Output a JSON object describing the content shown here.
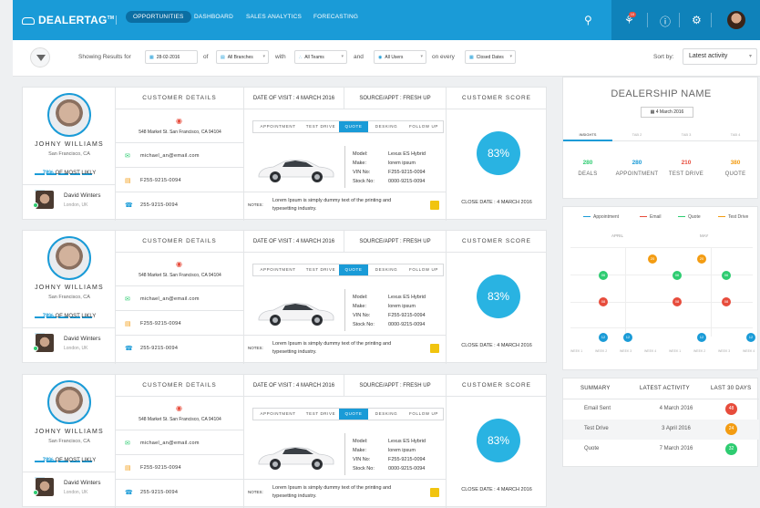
{
  "topbar": {
    "logo": "DEALERTAG",
    "logo_tm": "TM",
    "nav": [
      "OPPORTUNITIES",
      "DASHBOARD",
      "SALES ANALYTICS",
      "FORECASTING"
    ],
    "notification_count": "10",
    "accent": "#1a9bd7"
  },
  "filters": {
    "showing_label": "Showing Results for",
    "date": "28-02-2016",
    "of": "of",
    "branches": "All Branches",
    "with": "with",
    "teams": "All Teams",
    "and": "and",
    "users": "All Users",
    "on_every": "on every",
    "closed_dates": "Closed Dates",
    "sort_label": "Sort by:",
    "sort_value": "Latest activity"
  },
  "card_labels": {
    "customer_details": "CUSTOMER DETAILS",
    "date_of_visit_label": "DATE OF VISIT :",
    "source_label": "SOURCE/APPT :",
    "customer_score": "CUSTOMER SCORE",
    "tabs": [
      "APPOINTMENT",
      "TEST DRIVE",
      "QUOTE",
      "DESKING",
      "FOLLOW UP"
    ],
    "spec_labels": [
      "Model:",
      "Make:",
      "VIN No:",
      "Stock No:"
    ],
    "notes_label": "NOTES:",
    "close_date_label": "CLOSE DATE :",
    "most_likely": "OF MOST LIKLY"
  },
  "cards": [
    {
      "name": "JOHNY WILLIAMS",
      "location": "San Francisco, CA",
      "likely_pct": "78%",
      "agent_name": "David Winters",
      "agent_location": "London, UK",
      "address": "548 Market St. San Francisco, CA 94104",
      "email": "michael_an@email.com",
      "fax": "F255-9215-0094",
      "phone": "255-9215-0094",
      "visit_date": "4 MARCH 2016",
      "source": "FRESH UP",
      "model": "Lexus ES Hybrid",
      "make": "lorem ipsum",
      "vin": "F255-9215-0094",
      "stock": "0000-9215-0094",
      "notes": "Lorem Ipsum is simply dummy text of the printing and typesetting industry.",
      "score": "83%",
      "close_date": "4 MARCH 2016"
    },
    {
      "name": "JOHNY WILLIAMS",
      "location": "San Francisco, CA",
      "likely_pct": "78%",
      "agent_name": "David Winters",
      "agent_location": "London, UK",
      "address": "548 Market St. San Francisco, CA 94104",
      "email": "michael_an@email.com",
      "fax": "F255-9215-0094",
      "phone": "255-9215-0094",
      "visit_date": "4 MARCH 2016",
      "source": "FRESH UP",
      "model": "Lexus ES Hybrid",
      "make": "lorem ipsum",
      "vin": "F255-9215-0094",
      "stock": "0000-9215-0094",
      "notes": "Lorem Ipsum is simply dummy text of the printing and typesetting industry.",
      "score": "83%",
      "close_date": "4 MARCH 2016"
    },
    {
      "name": "JOHNY WILLIAMS",
      "location": "San Francisco, CA",
      "likely_pct": "78%",
      "agent_name": "David Winters",
      "agent_location": "London, UK",
      "address": "548 Market St. San Francisco, CA 94104",
      "email": "michael_an@email.com",
      "fax": "F255-9215-0094",
      "phone": "255-9215-0094",
      "visit_date": "4 MARCH 2016",
      "source": "FRESH UP",
      "model": "Lexus ES Hybrid",
      "make": "lorem ipsum",
      "vin": "F255-9215-0094",
      "stock": "0000-9215-0094",
      "notes": "Lorem Ipsum is simply dummy text of the printing and typesetting industry.",
      "score": "83%",
      "close_date": "4 MARCH 2016"
    }
  ],
  "dealership": {
    "name": "DEALERSHIP NAME",
    "date": "4 March 2016",
    "tabs": [
      "INSIGHTS",
      "TAB 2",
      "TAB 3",
      "TAB 4"
    ],
    "stats": [
      {
        "value": "280",
        "label": "DEALS",
        "color": "#2ecc71"
      },
      {
        "value": "280",
        "label": "APPOINTMENT",
        "color": "#1a9bd7"
      },
      {
        "value": "210",
        "label": "TEST DRIVE",
        "color": "#e74c3c"
      },
      {
        "value": "380",
        "label": "QUOTE",
        "color": "#f39c12"
      }
    ]
  },
  "activity_chart": {
    "legend": [
      {
        "name": "Appointment",
        "color": "#1a9bd7"
      },
      {
        "name": "Email",
        "color": "#e74c3c"
      },
      {
        "name": "Quote",
        "color": "#2ecc71"
      },
      {
        "name": "Test Drive",
        "color": "#f39c12"
      }
    ],
    "months": [
      "APRIL",
      "MAY"
    ],
    "weeks": [
      "WEEK 1",
      "WEEK 2",
      "WEEK 3",
      "WEEK 4",
      "WEEK 1",
      "WEEK 2",
      "WEEK 3",
      "WEEK 4"
    ],
    "dots": [
      {
        "label": "20",
        "color": "#f39c12",
        "week": 3,
        "row": 0
      },
      {
        "label": "20",
        "color": "#f39c12",
        "week": 5,
        "row": 0
      },
      {
        "label": "06",
        "color": "#2ecc71",
        "week": 1,
        "row": 1
      },
      {
        "label": "06",
        "color": "#2ecc71",
        "week": 4,
        "row": 1
      },
      {
        "label": "06",
        "color": "#2ecc71",
        "week": 6,
        "row": 1
      },
      {
        "label": "08",
        "color": "#e74c3c",
        "week": 1,
        "row": 2
      },
      {
        "label": "08",
        "color": "#e74c3c",
        "week": 4,
        "row": 2
      },
      {
        "label": "08",
        "color": "#e74c3c",
        "week": 6,
        "row": 2
      },
      {
        "label": "12",
        "color": "#1a9bd7",
        "week": 1,
        "row": 3
      },
      {
        "label": "12",
        "color": "#1a9bd7",
        "week": 2,
        "row": 3
      },
      {
        "label": "12",
        "color": "#1a9bd7",
        "week": 5,
        "row": 3
      },
      {
        "label": "12",
        "color": "#1a9bd7",
        "week": 7,
        "row": 3
      }
    ]
  },
  "summary": {
    "headers": [
      "SUMMARY",
      "LATEST ACTIVITY",
      "LAST 30 DAYS"
    ],
    "rows": [
      {
        "name": "Email Sent",
        "date": "4 March 2016",
        "count": "48",
        "color": "#e74c3c"
      },
      {
        "name": "Test Drive",
        "date": "3 April 2016",
        "count": "24",
        "color": "#f39c12"
      },
      {
        "name": "Quote",
        "date": "7 March 2016",
        "count": "32",
        "color": "#2ecc71"
      }
    ]
  }
}
